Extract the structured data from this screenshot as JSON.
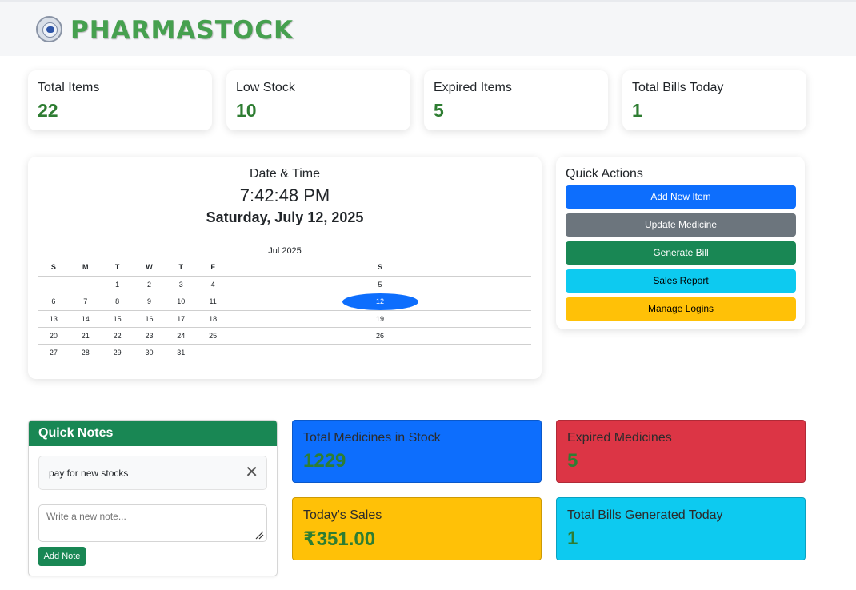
{
  "header": {
    "brand": "PHARMASTOCK",
    "logo_icon": "pharmastock-logo-icon"
  },
  "stats": [
    {
      "label": "Total Items",
      "value": "22"
    },
    {
      "label": "Low Stock",
      "value": "10"
    },
    {
      "label": "Expired Items",
      "value": "5"
    },
    {
      "label": "Total Bills Today",
      "value": "1"
    }
  ],
  "datetime": {
    "title": "Date & Time",
    "time": "7:42:48 PM",
    "date": "Saturday, July 12, 2025"
  },
  "calendar": {
    "month_label": "Jul 2025",
    "weekdays": [
      "S",
      "M",
      "T",
      "W",
      "T",
      "F",
      "S"
    ],
    "weeks": [
      [
        "",
        "",
        "1",
        "2",
        "3",
        "4",
        "5"
      ],
      [
        "6",
        "7",
        "8",
        "9",
        "10",
        "11",
        "12"
      ],
      [
        "13",
        "14",
        "15",
        "16",
        "17",
        "18",
        "19"
      ],
      [
        "20",
        "21",
        "22",
        "23",
        "24",
        "25",
        "26"
      ],
      [
        "27",
        "28",
        "29",
        "30",
        "31",
        "",
        ""
      ]
    ],
    "selected_day": "12",
    "selected_color": "#0d6efd"
  },
  "quick_actions": {
    "title": "Quick Actions",
    "buttons": [
      {
        "label": "Add New Item",
        "bg": "#0d6efd",
        "fg": "#ffffff"
      },
      {
        "label": "Update Medicine",
        "bg": "#6c757d",
        "fg": "#ffffff"
      },
      {
        "label": "Generate Bill",
        "bg": "#198754",
        "fg": "#ffffff"
      },
      {
        "label": "Sales Report",
        "bg": "#0dcaf0",
        "fg": "#000000"
      },
      {
        "label": "Manage Logins",
        "bg": "#ffc107",
        "fg": "#000000"
      }
    ]
  },
  "notes": {
    "title": "Quick Notes",
    "items": [
      "pay for new stocks"
    ],
    "input_placeholder": "Write a new note...",
    "add_label": "Add Note"
  },
  "tiles": [
    {
      "label": "Total Medicines in Stock",
      "value": "1229",
      "bg": "#0d6efd"
    },
    {
      "label": "Expired Medicines",
      "value": "5",
      "bg": "#dc3545"
    },
    {
      "label": "Today's Sales",
      "value": "₹351.00",
      "bg": "#ffc107"
    },
    {
      "label": "Total Bills Generated Today",
      "value": "1",
      "bg": "#0dcaf0"
    }
  ]
}
